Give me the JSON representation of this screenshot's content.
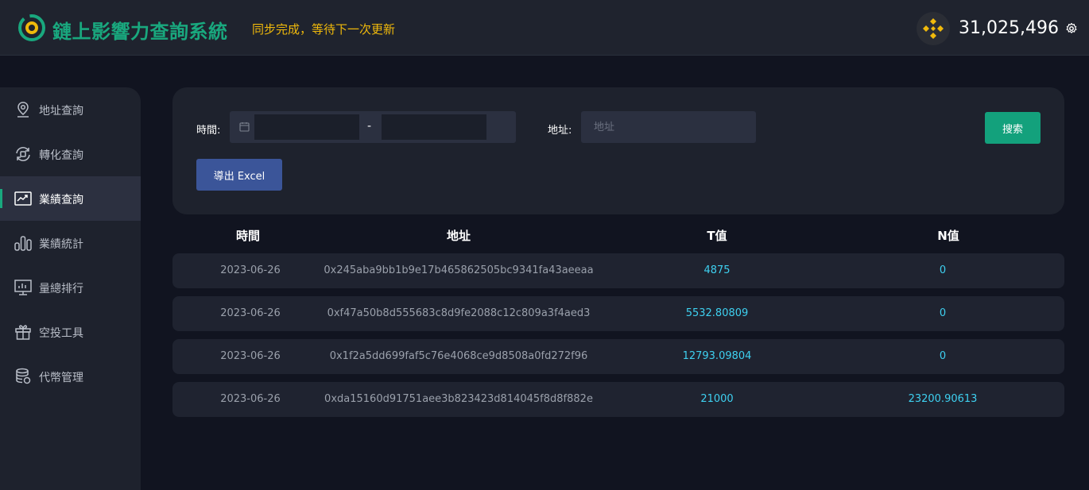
{
  "header": {
    "app_title": "鏈上影響力查詢系統",
    "sync_status": "同步完成，等待下一次更新",
    "balance": "31,025,496",
    "token_icon": "bnb-icon",
    "accent_color": "#19a87e",
    "status_color": "#f0b90b"
  },
  "sidebar": {
    "items": [
      {
        "label": "地址查詢",
        "icon": "map-pin-icon"
      },
      {
        "label": "轉化查詢",
        "icon": "convert-icon"
      },
      {
        "label": "業績查詢",
        "icon": "trend-chart-icon",
        "active": true
      },
      {
        "label": "業績統計",
        "icon": "bar-stats-icon"
      },
      {
        "label": "量總排行",
        "icon": "presentation-board-icon"
      },
      {
        "label": "空投工具",
        "icon": "gift-icon"
      },
      {
        "label": "代幣管理",
        "icon": "database-icon"
      }
    ]
  },
  "filter": {
    "time_label": "時間:",
    "date_start": "",
    "date_end": "",
    "date_separator": "-",
    "address_label": "地址:",
    "address_placeholder": "地址",
    "search_label": "搜索",
    "export_label": "導出 Excel"
  },
  "table": {
    "headers": [
      "時間",
      "地址",
      "T值",
      "N值"
    ],
    "rows": [
      {
        "time": "2023-06-26",
        "address": "0x245aba9bb1b9e17b465862505bc9341fa43aeeaa",
        "t": "4875",
        "n": "0"
      },
      {
        "time": "2023-06-26",
        "address": "0xf47a50b8d555683c8d9fe2088c12c809a3f4aed3",
        "t": "5532.80809",
        "n": "0"
      },
      {
        "time": "2023-06-26",
        "address": "0x1f2a5dd699faf5c76e4068ce9d8508a0fd272f96",
        "t": "12793.09804",
        "n": "0"
      },
      {
        "time": "2023-06-26",
        "address": "0xda15160d91751aee3b823423d814045f8d8f882e",
        "t": "21000",
        "n": "23200.90613"
      }
    ]
  }
}
